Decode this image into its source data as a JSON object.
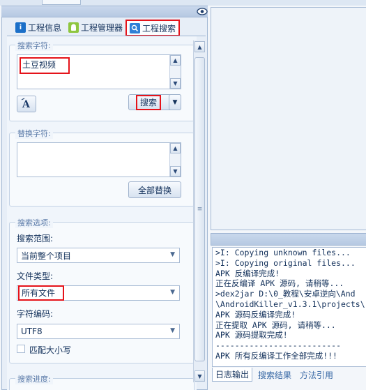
{
  "tabs": [
    {
      "label": "工程信息",
      "icon": "info-icon"
    },
    {
      "label": "工程管理器",
      "icon": "android-icon"
    },
    {
      "label": "工程搜索",
      "icon": "search-icon",
      "active": true
    }
  ],
  "search": {
    "group_title": "搜索字符:",
    "value": "土豆视频",
    "button_label": "搜索"
  },
  "replace": {
    "group_title": "替换字符:",
    "value": "",
    "button_label": "全部替换"
  },
  "options": {
    "group_title": "搜索选项:",
    "scope_label": "搜索范围:",
    "scope_value": "当前整个项目",
    "filetype_label": "文件类型:",
    "filetype_value": "所有文件",
    "encoding_label": "字符编码:",
    "encoding_value": "UTF8",
    "match_case_label": "匹配大小写"
  },
  "progress": {
    "group_title": "搜索进度:"
  },
  "log": {
    "lines": [
      ">I: Copying unknown files...",
      ">I: Copying original files...",
      "APK 反编译完成!",
      "正在反编译 APK 源码, 请稍等...",
      ">dex2jar D:\\0_教程\\安卓逆向\\And",
      "\\AndroidKiller_v1.3.1\\projects\\",
      "APK 源码反编译完成!",
      "正在提取 APK 源码, 请稍等...",
      "APK 源码提取完成!",
      "--------------------------",
      "APK 所有反编译工作全部完成!!!"
    ]
  },
  "bottom_tabs": [
    {
      "label": "日志输出",
      "active": true
    },
    {
      "label": "搜索结果"
    },
    {
      "label": "方法引用"
    }
  ],
  "colors": {
    "highlight": "#e5131a",
    "accent": "#1e3d6b"
  }
}
